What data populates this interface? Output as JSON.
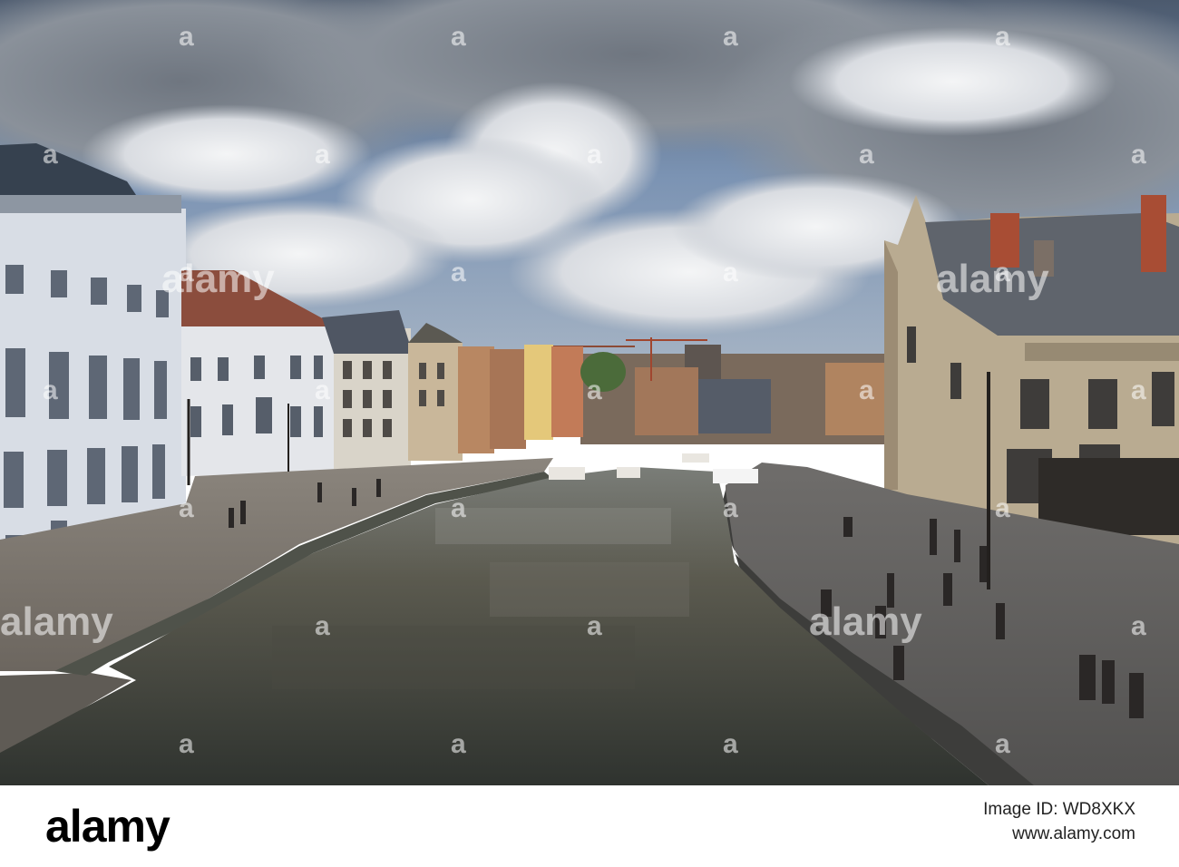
{
  "watermark": {
    "brand": "alamy",
    "letter": "a",
    "color": "#ffffff"
  },
  "footer": {
    "logo": "alamy",
    "image_id": "Image ID: WD8XKX",
    "site": "www.alamy.com"
  },
  "scene": {
    "description_colors": {
      "sky": "#6f8fb8",
      "cloud": "#e6e8ec",
      "water": "#5c5a4e",
      "quay": "#77716a"
    }
  }
}
